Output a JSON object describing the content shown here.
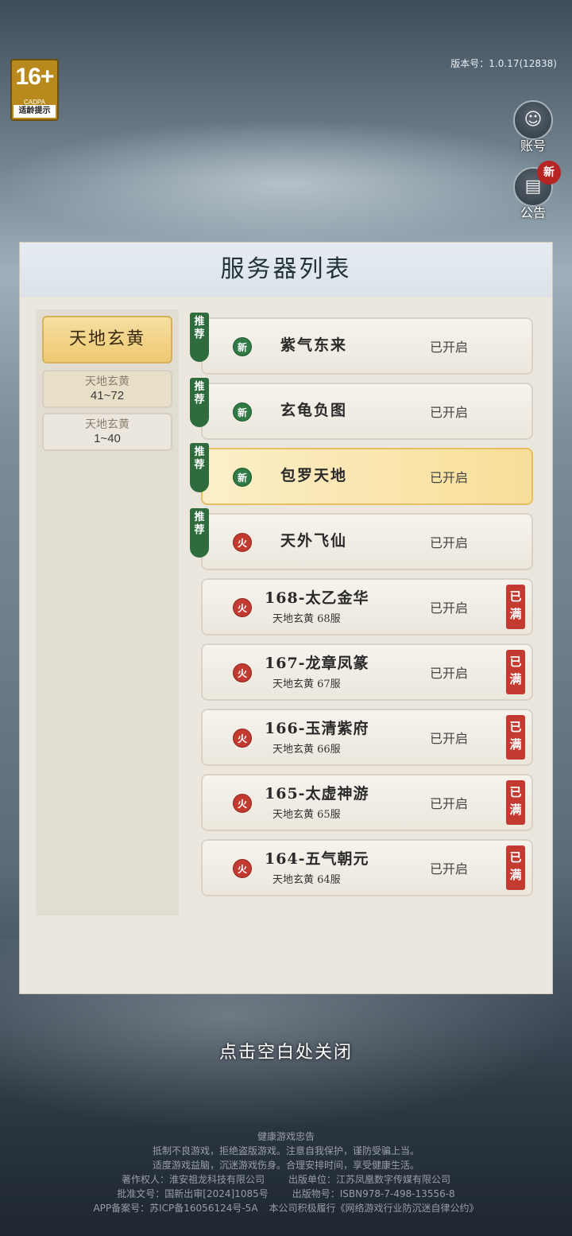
{
  "age_rating": {
    "number": "16+",
    "org": "CADPA",
    "tip": "适龄提示"
  },
  "version": "版本号：1.0.17(12838)",
  "side_buttons": {
    "account": {
      "label": "账号",
      "icon": "account-icon"
    },
    "notice": {
      "label": "公告",
      "icon": "notice-icon",
      "new_tag": "新"
    }
  },
  "panel": {
    "title": "服务器列表",
    "tabs": [
      {
        "label": "天地玄黄"
      },
      {
        "line1": "天地玄黄",
        "line2": "41~72"
      },
      {
        "line1": "天地玄黄",
        "line2": "1~40"
      }
    ],
    "servers": [
      {
        "ribbon": "推荐",
        "badge": "新",
        "name": "紫气东来",
        "sub": "",
        "status": "已开启",
        "full": ""
      },
      {
        "ribbon": "推荐",
        "badge": "新",
        "name": "玄龟负图",
        "sub": "",
        "status": "已开启",
        "full": ""
      },
      {
        "ribbon": "推荐",
        "badge": "新",
        "name": "包罗天地",
        "sub": "",
        "status": "已开启",
        "full": ""
      },
      {
        "ribbon": "推荐",
        "badge": "火",
        "name": "天外飞仙",
        "sub": "",
        "status": "已开启",
        "full": ""
      },
      {
        "ribbon": "",
        "badge": "火",
        "name": "168-太乙金华",
        "sub": "天地玄黄  68服",
        "status": "已开启",
        "full": "已满"
      },
      {
        "ribbon": "",
        "badge": "火",
        "name": "167-龙章凤篆",
        "sub": "天地玄黄  67服",
        "status": "已开启",
        "full": "已满"
      },
      {
        "ribbon": "",
        "badge": "火",
        "name": "166-玉清紫府",
        "sub": "天地玄黄  66服",
        "status": "已开启",
        "full": "已满"
      },
      {
        "ribbon": "",
        "badge": "火",
        "name": "165-太虚神游",
        "sub": "天地玄黄  65服",
        "status": "已开启",
        "full": "已满"
      },
      {
        "ribbon": "",
        "badge": "火",
        "name": "164-五气朝元",
        "sub": "天地玄黄  64服",
        "status": "已开启",
        "full": "已满"
      }
    ]
  },
  "close_tip": "点击空白处关闭",
  "footer": {
    "title": "健康游戏忠告",
    "line1": "抵制不良游戏，拒绝盗版游戏。注意自我保护，谨防受骗上当。",
    "line2": "适度游戏益脑，沉迷游戏伤身。合理安排时间，享受健康生活。",
    "copyright": "著作权人：淮安祖龙科技有限公司",
    "publisher": "出版单位：江苏凤凰数字传媒有限公司",
    "approval": "批准文号：国新出审[2024]1085号",
    "isbn": "出版物号：ISBN978-7-498-13556-8",
    "icp": "APP备案号：苏ICP备16056124号-5A",
    "pledge": "本公司积极履行《网络游戏行业防沉迷自律公约》"
  }
}
